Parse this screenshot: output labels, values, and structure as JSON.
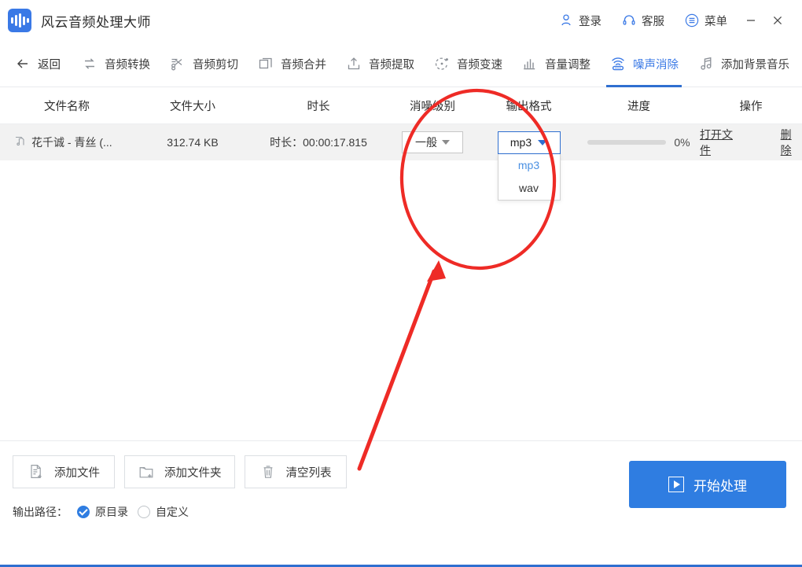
{
  "window": {
    "app_title": "风云音频处理大师",
    "logo_icon": "audio-wave-icon",
    "accent_color": "#2f7de1",
    "login_label": "登录",
    "support_label": "客服",
    "menu_label": "菜单",
    "minimize_label": "−",
    "close_label": "✕"
  },
  "toolbar": {
    "items": [
      {
        "label": "返回",
        "icon": "arrow-left-icon",
        "active": false
      },
      {
        "label": "音频转换",
        "icon": "convert-arrows-icon",
        "active": false
      },
      {
        "label": "音频剪切",
        "icon": "scissors-icon",
        "active": false
      },
      {
        "label": "音频合并",
        "icon": "merge-squares-icon",
        "active": false
      },
      {
        "label": "音频提取",
        "icon": "upload-icon",
        "active": false
      },
      {
        "label": "音频变速",
        "icon": "speed-circle-icon",
        "active": false
      },
      {
        "label": "音量调整",
        "icon": "bar-levels-icon",
        "active": false
      },
      {
        "label": "噪声消除",
        "icon": "noise-wifi-icon",
        "active": true
      },
      {
        "label": "添加背景音乐",
        "icon": "music-note-icon",
        "active": false
      }
    ]
  },
  "table": {
    "headers": [
      "文件名称",
      "文件大小",
      "时长",
      "消噪级别",
      "输出格式",
      "进度",
      "操作"
    ],
    "rows": [
      {
        "file_icon": "music-file-icon",
        "name": "花千诚 - 青丝 (...",
        "size": "312.74 KB",
        "duration": "时长：00:00:17.815",
        "noise_level": "一般",
        "output_format": "mp3",
        "format_options": [
          "mp3",
          "wav"
        ],
        "format_menu_open": true,
        "progress_value": 0,
        "progress_text": "0%",
        "open_label": "打开文件",
        "delete_label": "删除"
      }
    ]
  },
  "footer": {
    "buttons": [
      {
        "label": "添加文件",
        "icon": "file-plus-icon"
      },
      {
        "label": "添加文件夹",
        "icon": "folder-plus-icon"
      },
      {
        "label": "清空列表",
        "icon": "trash-icon"
      }
    ],
    "output_path_label": "输出路径：",
    "path_options": [
      {
        "label": "原目录",
        "selected": true
      },
      {
        "label": "自定义",
        "selected": false
      }
    ],
    "start_label": "开始处理",
    "start_icon": "play-icon"
  },
  "annotation": {
    "color": "#ee2b26",
    "ellipse_note": "highlight-output-format-dropdown",
    "arrow_note": "pointer-to-format-dropdown"
  }
}
